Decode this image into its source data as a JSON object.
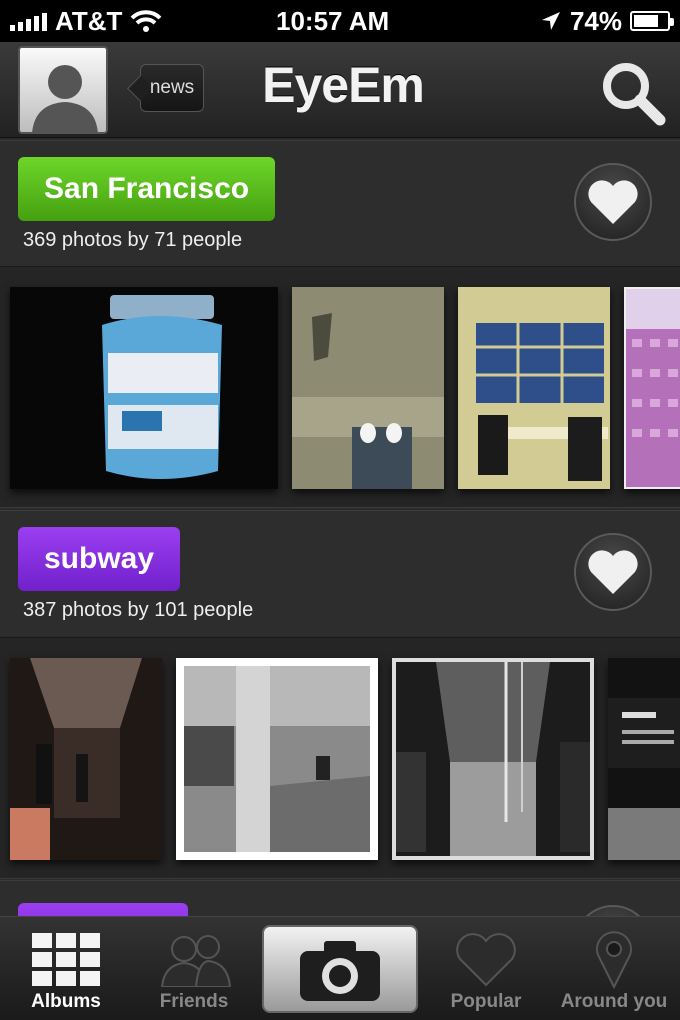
{
  "status_bar": {
    "carrier": "AT&T",
    "time": "10:57 AM",
    "battery": "74%",
    "battery_level": 0.74
  },
  "nav": {
    "back_label": "news",
    "title": "EyeEm"
  },
  "albums": [
    {
      "name": "San Francisco",
      "count_text": "369 photos by 71 people",
      "tag_color": "#5cc11a"
    },
    {
      "name": "subway",
      "count_text": "387 photos by 101 people",
      "tag_color": "#8a2ee6"
    }
  ],
  "tabs": [
    {
      "label": "Albums",
      "active": true
    },
    {
      "label": "Friends",
      "active": false
    },
    {
      "label": "Popular",
      "active": false
    },
    {
      "label": "Around you",
      "active": false
    }
  ],
  "colors": {
    "green_tag": "#5cc11a",
    "purple_tag": "#8a2ee6"
  }
}
